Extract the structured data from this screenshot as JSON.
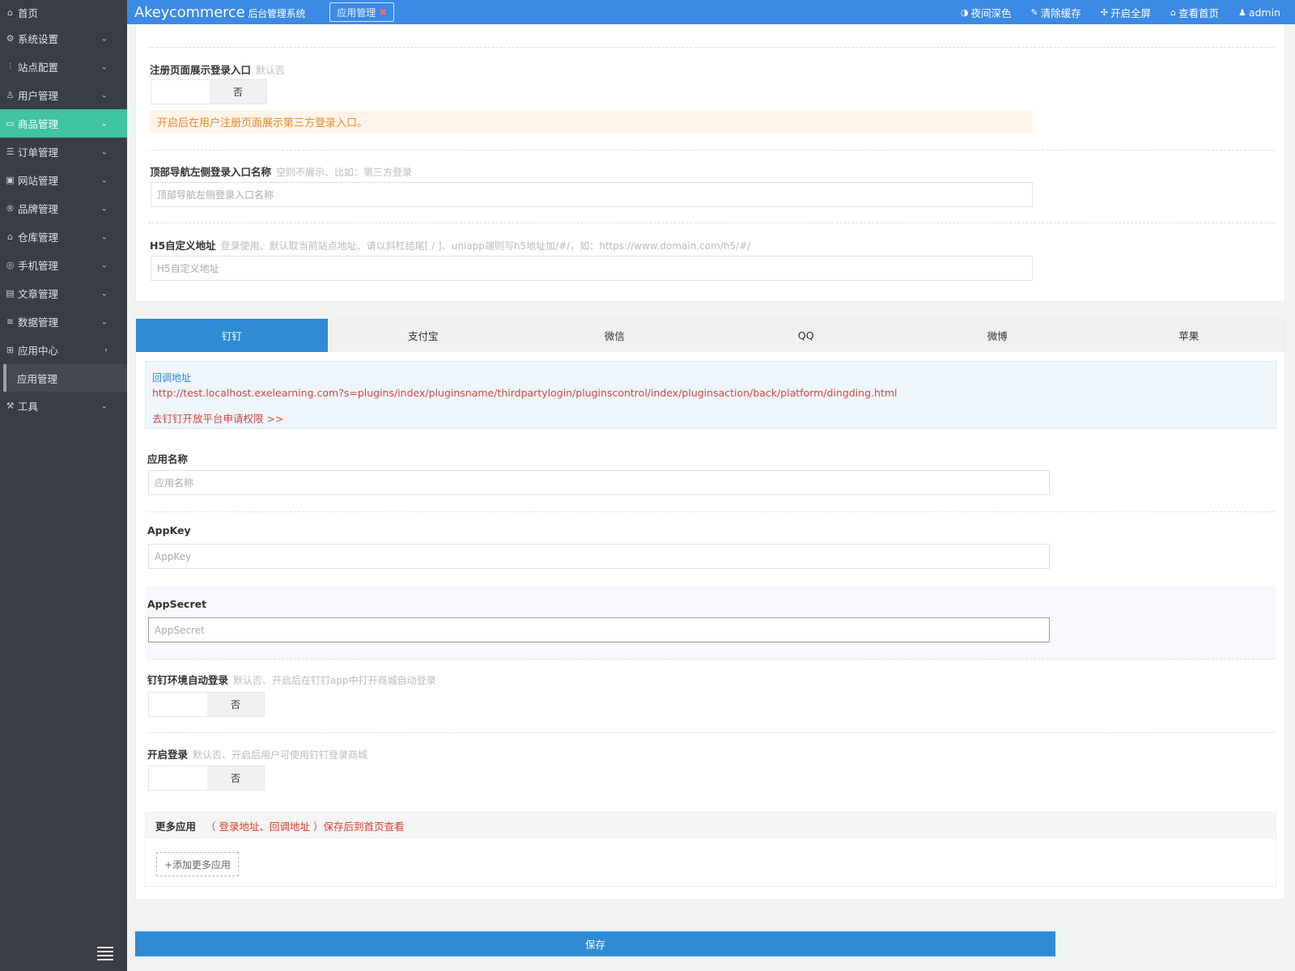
{
  "sidebar": {
    "items": [
      {
        "label": "首页",
        "icon": "home-icon"
      },
      {
        "label": "系统设置",
        "icon": "gear-icon"
      },
      {
        "label": "站点配置",
        "icon": "sliders-icon"
      },
      {
        "label": "用户管理",
        "icon": "user-icon"
      },
      {
        "label": "商品管理",
        "icon": "box-icon"
      },
      {
        "label": "订单管理",
        "icon": "list-icon"
      },
      {
        "label": "网站管理",
        "icon": "monitor-icon"
      },
      {
        "label": "品牌管理",
        "icon": "registered-icon"
      },
      {
        "label": "仓库管理",
        "icon": "warehouse-icon"
      },
      {
        "label": "手机管理",
        "icon": "mobile-icon"
      },
      {
        "label": "文章管理",
        "icon": "document-icon"
      },
      {
        "label": "数据管理",
        "icon": "database-icon"
      },
      {
        "label": "应用中心",
        "icon": "apps-icon"
      },
      {
        "label": "应用管理",
        "icon": ""
      },
      {
        "label": "工具",
        "icon": "tools-icon"
      }
    ],
    "active_color": "#3fc3a0"
  },
  "header": {
    "brand": "Akeycommerce",
    "brand_sub": "后台管理系统",
    "open_tab": "应用管理",
    "actions": [
      "夜间深色",
      "清除缓存",
      "开启全屏",
      "查看首页",
      "admin"
    ],
    "color": "#3b8ae5"
  },
  "top_form": {
    "register_login": {
      "label": "注册页面展示登录入口",
      "hint": "默认否",
      "switch": "否",
      "notice": "开启后在用户注册页面展示第三方登录入口。"
    },
    "nav_login_name": {
      "label": "顶部导航左侧登录入口名称",
      "hint": "空则不展示、比如：第三方登录",
      "placeholder": "顶部导航左侧登录入口名称"
    },
    "h5_url": {
      "label": "H5自定义地址",
      "hint": "登录使用、默认取当前站点地址、请以斜杠结尾[ / ]、uniapp端则写h5地址加/#/，如：https://www.domain.com/h5/#/",
      "placeholder": "H5自定义地址"
    }
  },
  "platform_tabs": [
    "钉钉",
    "支付宝",
    "微信",
    "QQ",
    "微博",
    "苹果"
  ],
  "active_tab": "钉钉",
  "callback": {
    "title": "回调地址",
    "url": "http://test.localhost.exelearning.com?s=plugins/index/pluginsname/thirdpartylogin/pluginscontrol/index/pluginsaction/back/platform/dingding.html",
    "apply_link": "去钉钉开放平台申请权限 >>"
  },
  "fields": {
    "app_name": {
      "label": "应用名称",
      "placeholder": "应用名称"
    },
    "app_key": {
      "label": "AppKey",
      "placeholder": "AppKey"
    },
    "app_secret": {
      "label": "AppSecret",
      "placeholder": "AppSecret"
    },
    "auto_login": {
      "label": "钉钉环境自动登录",
      "hint": "默认否、开启后在钉钉app中打开商城自动登录",
      "switch": "否"
    },
    "enable_login": {
      "label": "开启登录",
      "hint": "默认否、开启后用户可使用钉钉登录商城",
      "switch": "否"
    }
  },
  "more_apps": {
    "title": "更多应用",
    "note": "（ 登录地址、回调地址 ）保存后到首页查看",
    "add_button": "+添加更多应用"
  },
  "save_button": "保存"
}
